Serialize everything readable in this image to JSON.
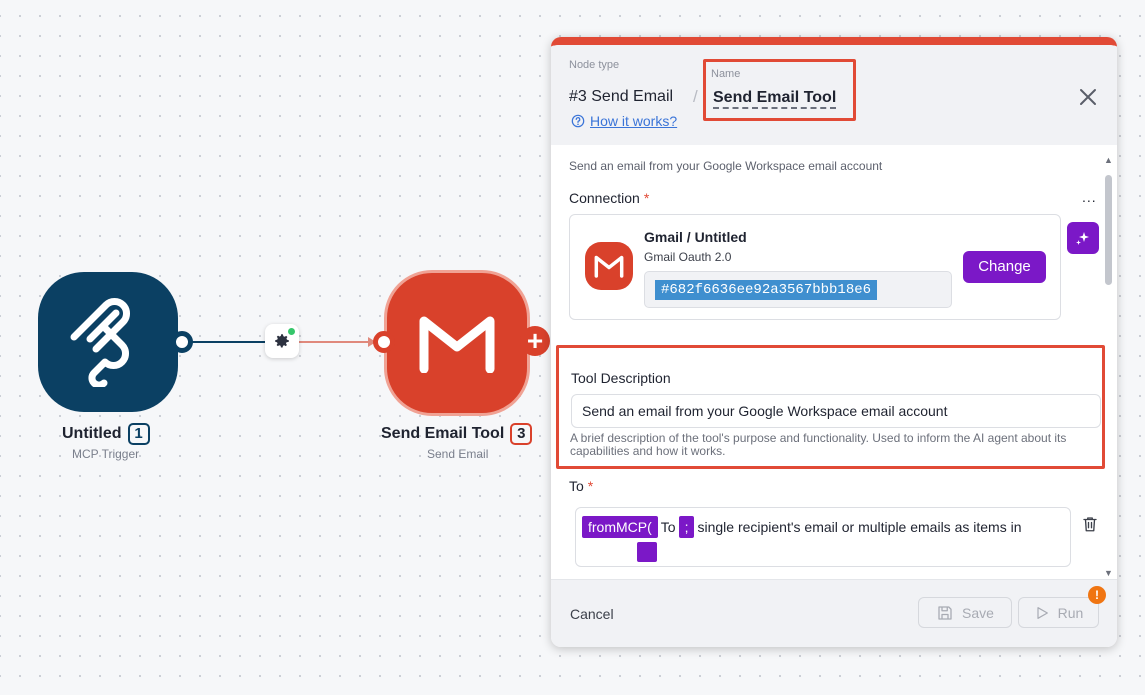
{
  "canvas": {
    "node_mcp": {
      "title": "Untitled",
      "badge": "1",
      "subtitle": "MCP Trigger",
      "icon": "mcp-icon"
    },
    "node_gmail": {
      "title": "Send Email Tool",
      "badge": "3",
      "subtitle": "Send Email",
      "icon": "gmail-icon",
      "add_glyph": "+"
    },
    "edge_button_icon": "gear-icon",
    "colors": {
      "mcp": "#0b4063",
      "gmail": "#d9412b",
      "status_dot": "#36c66b"
    }
  },
  "panel": {
    "node_type_label": "Node type",
    "node_type_value": "#3 Send Email",
    "slash": "/",
    "name_label": "Name",
    "name_value": "Send Email Tool",
    "how_link": "How it works?",
    "description": "Send an email from your Google Workspace email account",
    "connection": {
      "label": "Connection",
      "required": "*",
      "menu": "...",
      "name": "Gmail / Untitled",
      "type": "Gmail Oauth 2.0",
      "id": "#682f6636ee92a3567bbb18e6",
      "change_label": "Change"
    },
    "tool_description": {
      "label": "Tool Description",
      "value": "Send an email from your Google Workspace email account",
      "hint": "A brief description of the tool's purpose and functionality. Used to inform the AI agent about its capabilities and how it works."
    },
    "to": {
      "label": "To",
      "required": "*",
      "pill_1": "fromMCP(",
      "text_1": "To",
      "pill_2": ";",
      "text_2": "single recipient's email or multiple emails as items in"
    },
    "footer": {
      "cancel": "Cancel",
      "save": "Save",
      "run": "Run",
      "alert": "!"
    },
    "accent": "#e14a36",
    "primary": "#7b18c7"
  }
}
